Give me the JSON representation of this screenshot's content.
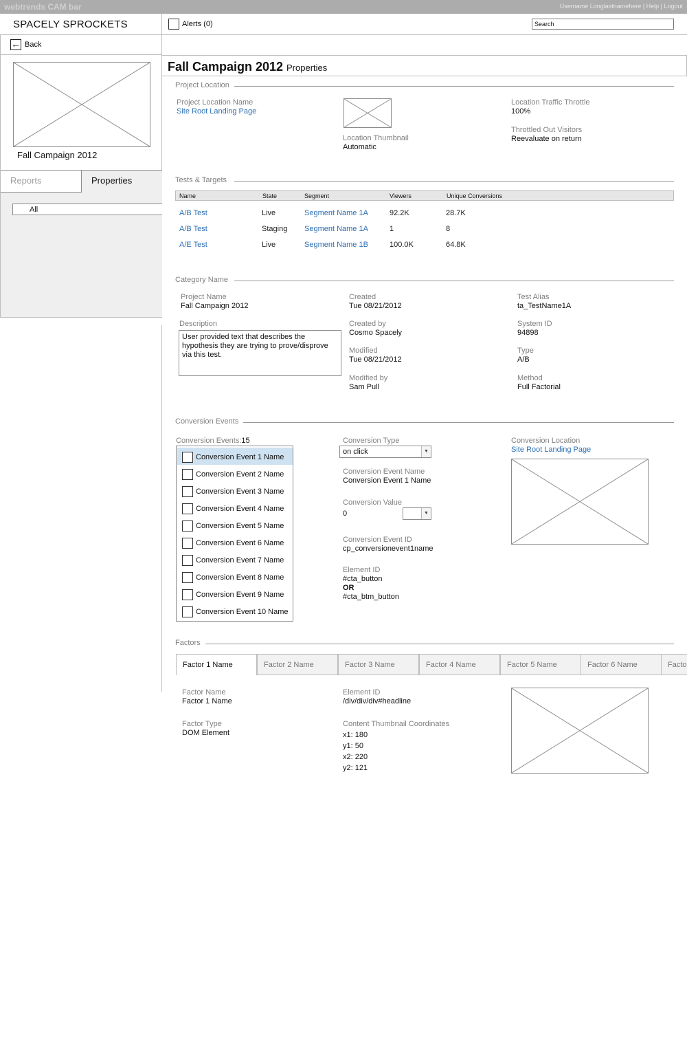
{
  "cambar": {
    "brand": "webtrends CAM bar",
    "user_links": "Username Longlastnamehere | Help | Logout"
  },
  "header": {
    "logo": "SPACELY SPROCKETS",
    "alerts": "Alerts (0)",
    "search_value": "Search"
  },
  "left": {
    "back": "Back",
    "project_name": "Fall Campaign 2012",
    "tabs": [
      "Reports",
      "Properties"
    ],
    "filter": "All"
  },
  "page": {
    "title": "Fall Campaign 2012",
    "subtitle": "Properties"
  },
  "project_location": {
    "heading": "Project Location",
    "name_label": "Project Location Name",
    "name_value": "Site Root Landing Page",
    "thumb_label": "Location Thumbnail",
    "thumb_value": "Automatic",
    "throttle_label": "Location Traffic Throttle",
    "throttle_value": "100%",
    "throttled_label": "Throttled Out Visitors",
    "throttled_value": "Reevaluate on return"
  },
  "tests": {
    "heading": "Tests & Targets",
    "columns": [
      "Name",
      "State",
      "Segment",
      "Viewers",
      "Unique Conversions"
    ],
    "rows": [
      {
        "name": "A/B Test",
        "state": "Live",
        "segment": "Segment Name 1A",
        "viewers": "92.2K",
        "conversions": "28.7K"
      },
      {
        "name": "A/B Test",
        "state": "Staging",
        "segment": "Segment Name 1A",
        "viewers": "1",
        "conversions": "8"
      },
      {
        "name": "A/E Test",
        "state": "Live",
        "segment": "Segment Name 1B",
        "viewers": "100.0K",
        "conversions": "64.8K"
      }
    ]
  },
  "category": {
    "heading": "Category Name",
    "project_name_label": "Project Name",
    "project_name": "Fall Campaign 2012",
    "description_label": "Description",
    "description": "User provided text that describes the hypothesis they are trying to prove/disprove via this test.",
    "created_label": "Created",
    "created": "Tue 08/21/2012",
    "created_by_label": "Created by",
    "created_by": "Cosmo Spacely",
    "modified_label": "Modified",
    "modified": "Tue 08/21/2012",
    "modified_by_label": "Modified by",
    "modified_by": "Sam Pull",
    "alias_label": "Test Alias",
    "alias": "ta_TestName1A",
    "system_id_label": "System ID",
    "system_id": "94898",
    "type_label": "Type",
    "type": "A/B",
    "method_label": "Method",
    "method": "Full Factorial"
  },
  "conversion": {
    "heading": "Conversion Events",
    "count_label": "Conversion Events:",
    "count": "15",
    "events": [
      "Conversion Event 1 Name",
      "Conversion Event 2 Name",
      "Conversion Event 3 Name",
      "Conversion Event 4 Name",
      "Conversion Event 5 Name",
      "Conversion Event 6 Name",
      "Conversion Event 7 Name",
      "Conversion Event 8 Name",
      "Conversion Event 9 Name",
      "Conversion Event 10 Name"
    ],
    "type_label": "Conversion Type",
    "type_value": "on click",
    "event_name_label": "Conversion Event Name",
    "event_name": "Conversion Event 1 Name",
    "value_label": "Conversion Value",
    "value": "0",
    "event_id_label": "Conversion Event ID",
    "event_id": "cp_conversionevent1name",
    "element_id_label": "Element ID",
    "element_id_1": "#cta_button",
    "element_or": "OR",
    "element_id_2": "#cta_btm_button",
    "location_label": "Conversion Location",
    "location_value": "Site Root Landing Page"
  },
  "factors": {
    "heading": "Factors",
    "tabs": [
      "Factor 1 Name",
      "Factor 2 Name",
      "Factor 3 Name",
      "Factor 4 Name",
      "Factor 5 Name",
      "Factor 6 Name",
      "Facto"
    ],
    "factor_name_label": "Factor Name",
    "factor_name": "Factor 1 Name",
    "factor_type_label": "Factor Type",
    "factor_type": "DOM Element",
    "element_id_label": "Element ID",
    "element_id": "/div/div/div#headline",
    "coords_label": "Content Thumbnail Coordinates",
    "coords": [
      "x1: 180",
      "y1: 50",
      "x2: 220",
      "y2: 121"
    ]
  }
}
